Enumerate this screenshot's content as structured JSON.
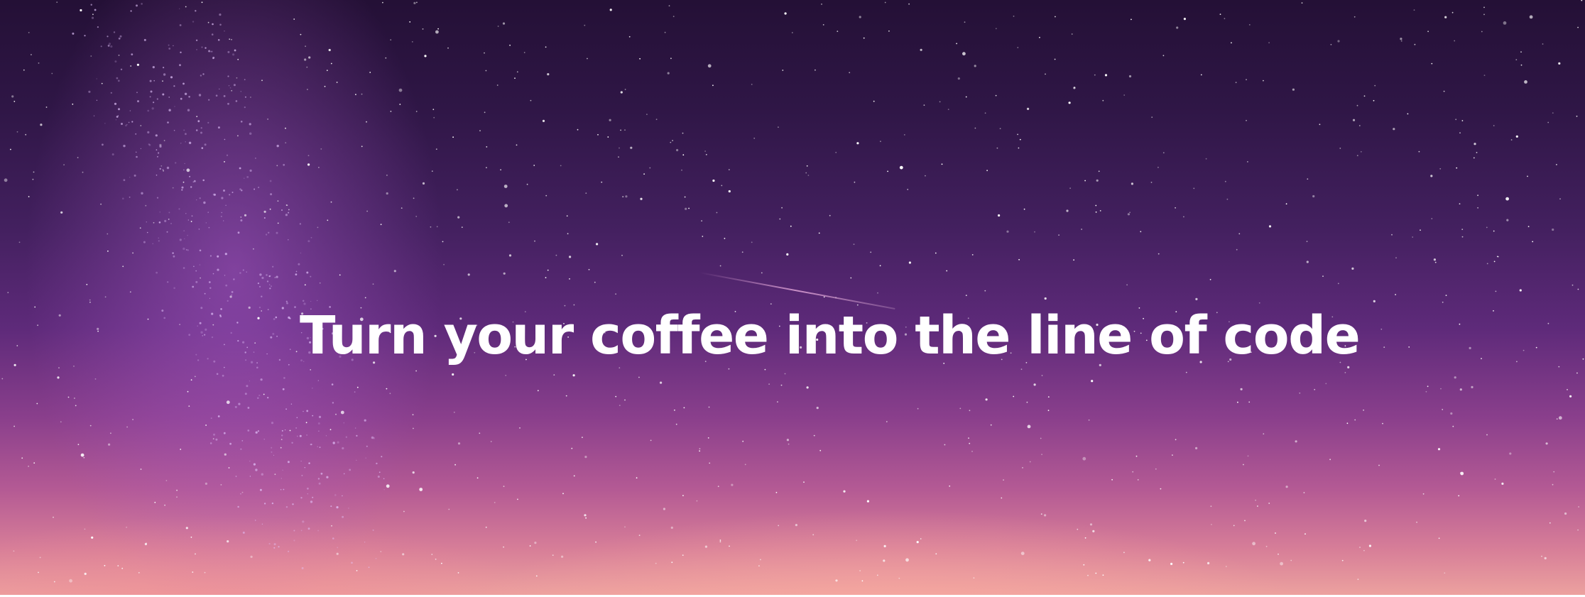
{
  "hero": {
    "headline": "Turn your coffee into the line of code"
  }
}
